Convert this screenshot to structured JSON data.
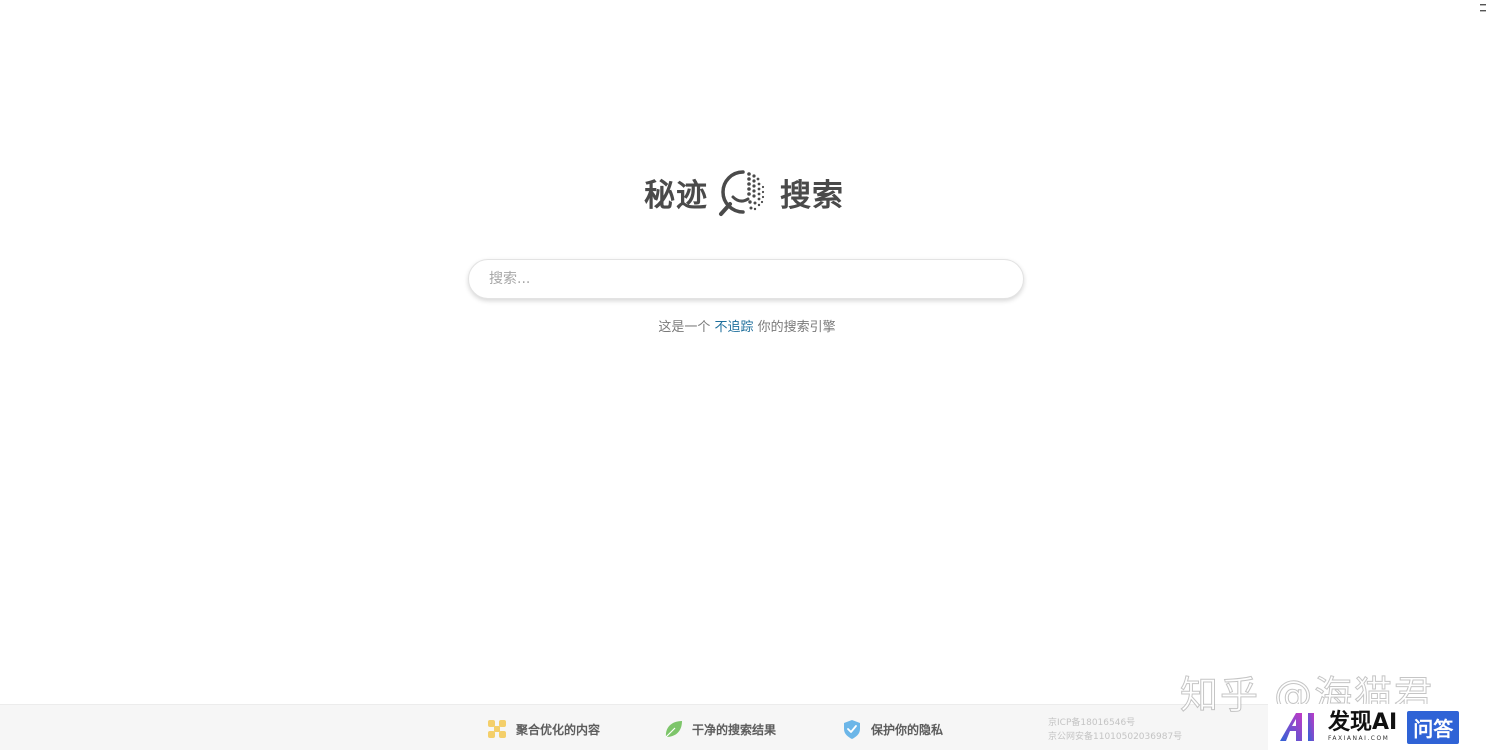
{
  "header": {
    "menu_icon": "menu-icon"
  },
  "logo": {
    "left_text": "秘迹",
    "right_text": "搜索",
    "mark_icon": "magnifier-smile-icon"
  },
  "search": {
    "placeholder": "搜索...",
    "value": ""
  },
  "tagline": {
    "prefix": "这是一个",
    "link": "不追踪",
    "suffix": "你的搜索引擎"
  },
  "footer": {
    "features": [
      {
        "label": "聚合优化的内容",
        "icon": "clover-icon",
        "color": "#f4cf6a"
      },
      {
        "label": "干净的搜索结果",
        "icon": "leaf-icon",
        "color": "#7dc56a"
      },
      {
        "label": "保护你的隐私",
        "icon": "shield-check-icon",
        "color": "#6cb6e8"
      }
    ],
    "icp": {
      "line1": "京ICP备18016546号",
      "line2": "京公网安备11010502036987号"
    }
  },
  "watermark": {
    "text": "知乎 @海猫君"
  },
  "badge": {
    "logo_icon": "ai-logo-icon",
    "main": "发现AI",
    "sub": "FAXIANAI.COM",
    "tag": "问答"
  },
  "colors": {
    "link": "#1e6f9c",
    "logo_text": "#4a4a4a",
    "badge_blue": "#2f63d6"
  }
}
